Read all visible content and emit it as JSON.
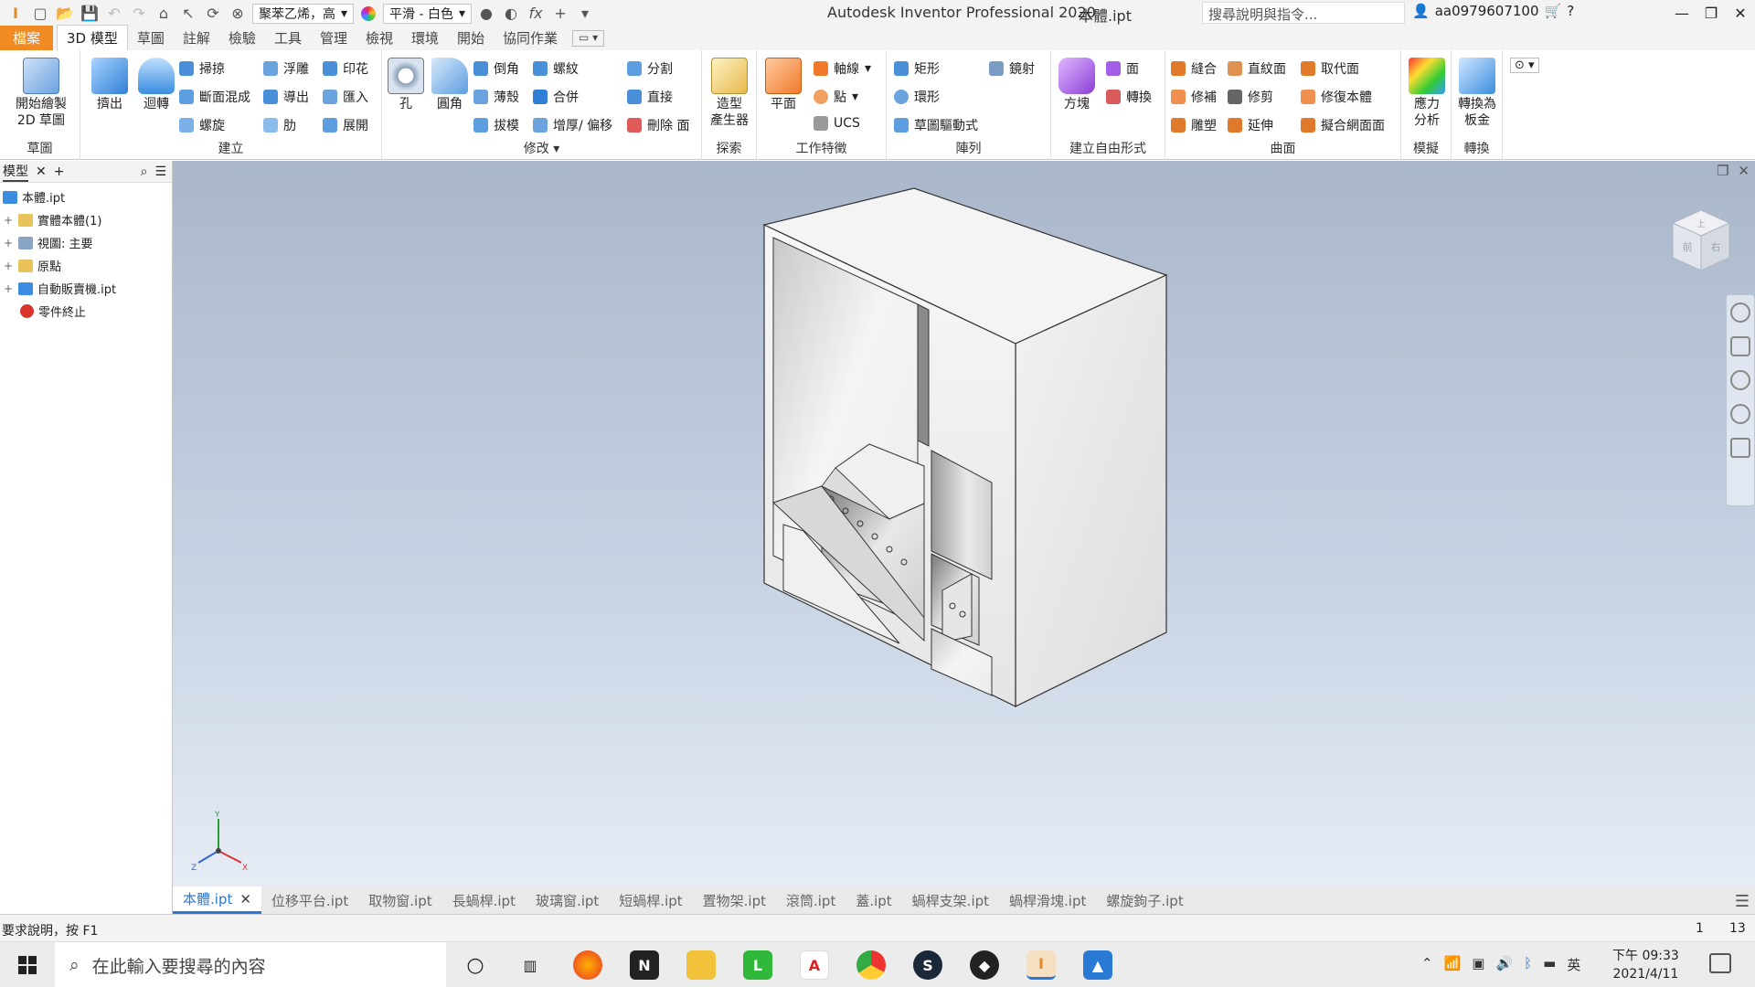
{
  "titlebar": {
    "app_title": "Autodesk Inventor Professional 2020",
    "doc_title": "本體.ipt",
    "material": "聚苯乙烯，高",
    "appearance": "平滑 - 白色",
    "search_placeholder": "搜尋說明與指令...",
    "user": "aa0979607100"
  },
  "tabs": [
    "檔案",
    "3D 模型",
    "草圖",
    "註解",
    "檢驗",
    "工具",
    "管理",
    "檢視",
    "環境",
    "開始",
    "協同作業"
  ],
  "ribbon": {
    "sketch": {
      "title": "草圖",
      "start": "開始繪製\n2D 草圖"
    },
    "create": {
      "title": "建立",
      "extrude": "擠出",
      "revolve": "迴轉",
      "sweep": "掃掠",
      "loft": "斷面混成",
      "coil": "螺旋",
      "emboss": "浮雕",
      "derive": "導出",
      "rib": "肋",
      "decal": "印花",
      "import": "匯入",
      "unfold": "展開"
    },
    "modify": {
      "title": "修改",
      "hole": "孔",
      "fillet": "圓角",
      "chamfer": "倒角",
      "shell": "薄殼",
      "draft": "拔模",
      "thread": "螺紋",
      "combine": "合併",
      "thicken": "增厚/ 偏移",
      "split": "分割",
      "direct": "直接",
      "delete_face": "刪除 面"
    },
    "explore": {
      "title": "探索",
      "shape_gen": "造型\n產生器"
    },
    "work": {
      "title": "工作特徵",
      "plane": "平面",
      "axis": "軸線",
      "point": "點",
      "ucs": "UCS"
    },
    "pattern": {
      "title": "陣列",
      "rect": "矩形",
      "circ": "環形",
      "sketch_driven": "草圖驅動式",
      "mirror": "鏡射"
    },
    "freeform": {
      "title": "建立自由形式",
      "box": "方塊",
      "face": "面",
      "convert": "轉換"
    },
    "surface": {
      "title": "曲面",
      "stitch": "縫合",
      "ruled": "直紋面",
      "replace": "取代面",
      "patch": "修補",
      "trim": "修剪",
      "repair": "修復本體",
      "sculpt": "雕塑",
      "extend": "延伸",
      "fit_mesh": "擬合網面面"
    },
    "simulation": {
      "title": "模擬",
      "stress": "應力\n分析"
    },
    "convert": {
      "title": "轉換",
      "sheet_metal": "轉換為\n板金"
    }
  },
  "browser": {
    "tab": "模型",
    "nodes": [
      {
        "label": "本體.ipt",
        "expand": ""
      },
      {
        "label": "實體本體(1)",
        "expand": "+"
      },
      {
        "label": "視圖: 主要",
        "expand": "+"
      },
      {
        "label": "原點",
        "expand": "+"
      },
      {
        "label": "自動販賣機.ipt",
        "expand": "+"
      },
      {
        "label": "零件終止",
        "expand": ""
      }
    ]
  },
  "navcube": {
    "face_front": "前",
    "face_right": "右",
    "face_top": "上"
  },
  "triad": {
    "x": "X",
    "y": "Y",
    "z": "Z"
  },
  "doc_tabs": [
    "本體.ipt",
    "位移平台.ipt",
    "取物窗.ipt",
    "長蝸桿.ipt",
    "玻璃窗.ipt",
    "短蝸桿.ipt",
    "置物架.ipt",
    "滾筒.ipt",
    "蓋.ipt",
    "蝸桿支架.ipt",
    "蝸桿滑塊.ipt",
    "螺旋鉤子.ipt"
  ],
  "status": {
    "text": "要求說明，按 F1",
    "n1": "1",
    "n2": "13"
  },
  "taskbar": {
    "search_placeholder": "在此輸入要搜尋的內容",
    "time": "下午 09:33",
    "date": "2021/4/11",
    "ime": "英"
  },
  "colors": {
    "file_tab": "#f28a24",
    "active_doc_tab": "#2a7ad5",
    "viewport_top": "#aab7cb",
    "viewport_bottom": "#e6ecf5"
  }
}
